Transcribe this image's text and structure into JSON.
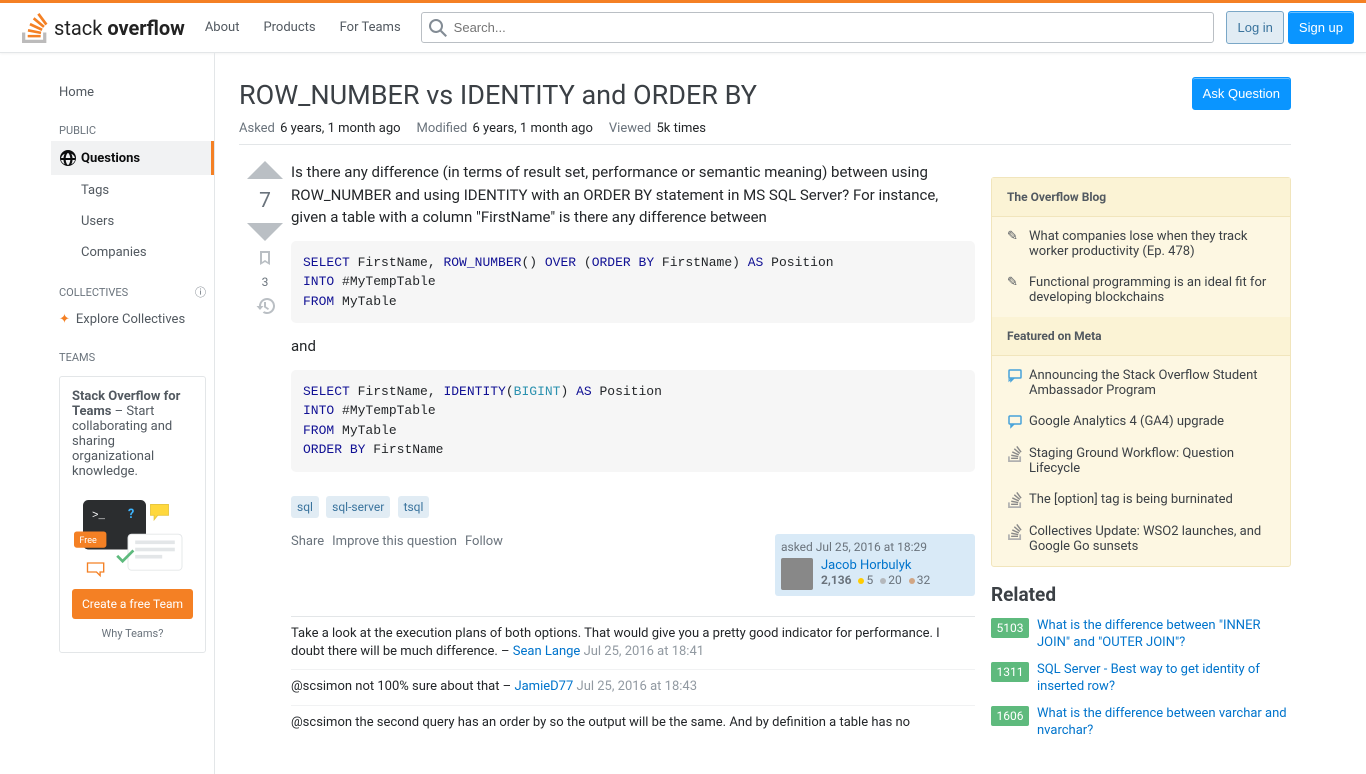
{
  "header": {
    "logo_text_1": "stack",
    "logo_text_2": "overflow",
    "nav": {
      "about": "About",
      "products": "Products",
      "for_teams": "For Teams"
    },
    "search_placeholder": "Search...",
    "login": "Log in",
    "signup": "Sign up"
  },
  "leftnav": {
    "home": "Home",
    "public_label": "PUBLIC",
    "questions": "Questions",
    "tags": "Tags",
    "users": "Users",
    "companies": "Companies",
    "collectives_label": "COLLECTIVES",
    "explore_collectives": "Explore Collectives",
    "teams_label": "TEAMS",
    "teams_promo_title": "Stack Overflow for Teams",
    "teams_promo_body": " – Start collaborating and sharing organizational knowledge.",
    "free_badge": "Free",
    "create_team": "Create a free Team",
    "why_teams": "Why Teams?"
  },
  "question": {
    "title": "ROW_NUMBER vs IDENTITY and ORDER BY",
    "ask_button": "Ask Question",
    "asked_label": "Asked",
    "asked_value": "6 years, 1 month ago",
    "modified_label": "Modified",
    "modified_value": "6 years, 1 month ago",
    "viewed_label": "Viewed",
    "viewed_value": "5k times",
    "votes": "7",
    "bookmark_count": "3",
    "body": "Is there any difference (in terms of result set, performance or semantic meaning) between using ROW_NUMBER and using IDENTITY with an ORDER BY statement in MS SQL Server? For instance, given a table with a column \"FirstName\" is there any difference between",
    "and_text": "and",
    "tags": [
      "sql",
      "sql-server",
      "tsql"
    ],
    "actions": {
      "share": "Share",
      "improve": "Improve this question",
      "follow": "Follow"
    },
    "usercard": {
      "action": "asked Jul 25, 2016 at 18:29",
      "name": "Jacob Horbulyk",
      "rep": "2,136",
      "gold": "5",
      "silver": "20",
      "bronze": "32"
    },
    "comments": [
      {
        "text": "Take a look at the execution plans of both options. That would give you a pretty good indicator for performance. I doubt there will be much difference. – ",
        "user": "Sean Lange",
        "time": "Jul 25, 2016 at 18:41"
      },
      {
        "text": "@scsimon not 100% sure about that – ",
        "user": "JamieD77",
        "time": "Jul 25, 2016 at 18:43"
      },
      {
        "text": "@scsimon the second query has an order by so the output will be the same. And by definition a table has no ",
        "user": "",
        "time": ""
      }
    ]
  },
  "rightbar": {
    "blog_header": "The Overflow Blog",
    "blog_items": [
      "What companies lose when they track worker productivity (Ep. 478)",
      "Functional programming is an ideal fit for developing blockchains"
    ],
    "meta_header": "Featured on Meta",
    "meta_items": [
      {
        "type": "chat",
        "text": "Announcing the Stack Overflow Student Ambassador Program"
      },
      {
        "type": "chat",
        "text": "Google Analytics 4 (GA4) upgrade"
      },
      {
        "type": "so",
        "text": "Staging Ground Workflow: Question Lifecycle"
      },
      {
        "type": "so",
        "text": "The [option] tag is being burninated"
      },
      {
        "type": "so",
        "text": "Collectives Update: WSO2 launches, and Google Go sunsets"
      }
    ],
    "related_header": "Related",
    "related": [
      {
        "score": "5103",
        "text": "What is the difference between \"INNER JOIN\" and \"OUTER JOIN\"?"
      },
      {
        "score": "1311",
        "text": "SQL Server - Best way to get identity of inserted row?"
      },
      {
        "score": "1606",
        "text": "What is the difference between varchar and nvarchar?"
      }
    ]
  }
}
